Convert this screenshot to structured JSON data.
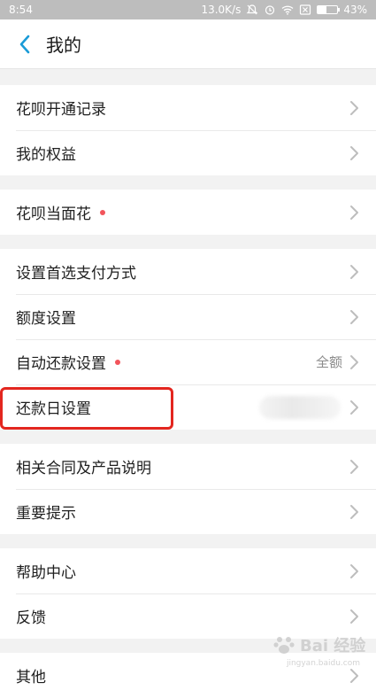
{
  "status_bar": {
    "time": "8:54",
    "network_speed": "13.0K/s",
    "battery_text": "43%",
    "battery_level": 0.43,
    "icons": [
      "mute-bell-icon",
      "alarm-icon",
      "wifi-icon",
      "sim-x-icon",
      "battery-icon"
    ]
  },
  "header": {
    "title": "我的",
    "back_icon": "chevron-left-icon"
  },
  "groups": [
    [
      {
        "label": "花呗开通记录"
      },
      {
        "label": "我的权益"
      }
    ],
    [
      {
        "label": "花呗当面花",
        "dot": true
      }
    ],
    [
      {
        "label": "设置首选支付方式"
      },
      {
        "label": "额度设置"
      },
      {
        "label": "自动还款设置",
        "dot": true,
        "value": "全额"
      },
      {
        "label": "还款日设置",
        "blurred_value": true,
        "highlighted": true
      }
    ],
    [
      {
        "label": "相关合同及产品说明"
      },
      {
        "label": "重要提示"
      }
    ],
    [
      {
        "label": "帮助中心"
      },
      {
        "label": "反馈"
      }
    ],
    [
      {
        "label": "其他"
      }
    ]
  ],
  "colors": {
    "accent": "#1a9bd7",
    "dot": "#f2545b",
    "highlight": "#e3261f",
    "background": "#f2f2f2"
  },
  "watermark": {
    "text": "Bai  经验",
    "sub": "jingyan.baidu.com"
  }
}
